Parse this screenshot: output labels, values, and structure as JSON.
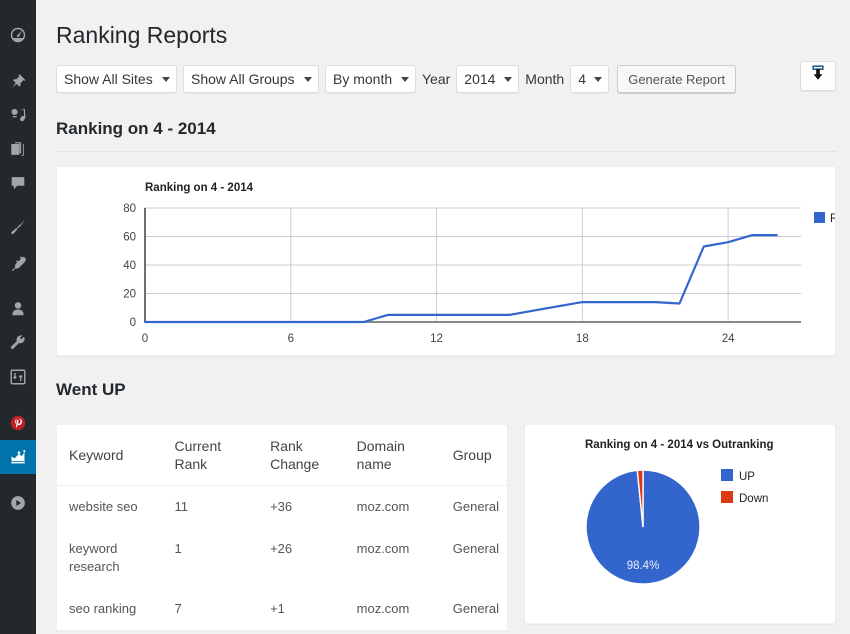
{
  "sidebar": {
    "items": [
      {
        "name": "dashboard",
        "icon": "dashboard-icon",
        "active": false
      },
      {
        "name": "posts",
        "icon": "pin-icon",
        "active": false
      },
      {
        "name": "media",
        "icon": "media-icon",
        "active": false
      },
      {
        "name": "pages",
        "icon": "pages-icon",
        "active": false
      },
      {
        "name": "comments",
        "icon": "comment-icon",
        "active": false
      },
      {
        "name": "appearance",
        "icon": "brush-icon",
        "active": false
      },
      {
        "name": "plugins",
        "icon": "plug-icon",
        "active": false
      },
      {
        "name": "users",
        "icon": "user-icon",
        "active": false
      },
      {
        "name": "tools",
        "icon": "wrench-icon",
        "active": false
      },
      {
        "name": "settings",
        "icon": "sliders-icon",
        "active": false
      },
      {
        "name": "pinterest",
        "icon": "pinterest-icon",
        "active": false
      },
      {
        "name": "rankings",
        "icon": "chart-icon",
        "active": true
      },
      {
        "name": "media-play",
        "icon": "play-icon",
        "active": false
      }
    ]
  },
  "header": {
    "title": "Ranking Reports"
  },
  "toolbar": {
    "site_filter": {
      "value": "Show All Sites",
      "options": [
        "Show All Sites"
      ]
    },
    "group_filter": {
      "value": "Show All Groups",
      "options": [
        "Show All Groups"
      ]
    },
    "period_filter": {
      "value": "By month",
      "options": [
        "By month"
      ]
    },
    "year_label": "Year",
    "year_value": "2014",
    "month_label": "Month",
    "month_value": "4",
    "generate_label": "Generate Report",
    "export_icon": "download-icon"
  },
  "sections": {
    "ranking_heading": "Ranking on 4 - 2014",
    "went_up_heading": "Went UP"
  },
  "table": {
    "columns": [
      "Keyword",
      "Current Rank",
      "Rank Change",
      "Domain name",
      "Group"
    ],
    "rows": [
      {
        "keyword": "website seo",
        "current_rank": "11",
        "rank_change": "+36",
        "domain": "moz.com",
        "group": "General"
      },
      {
        "keyword": "keyword research",
        "current_rank": "1",
        "rank_change": "+26",
        "domain": "moz.com",
        "group": "General"
      },
      {
        "keyword": "seo ranking",
        "current_rank": "7",
        "rank_change": "+1",
        "domain": "moz.com",
        "group": "General"
      }
    ]
  },
  "colors": {
    "series_blue": "#3366cc",
    "series_red": "#dc3912",
    "sidebar_bg": "#23282d",
    "sidebar_active": "#0073aa",
    "page_bg": "#f1f1f1"
  },
  "chart_data": [
    {
      "type": "line",
      "title": "Ranking on 4 - 2014",
      "xlabel": "",
      "ylabel": "",
      "xlim": [
        0,
        27
      ],
      "ylim": [
        0,
        80
      ],
      "xticks": [
        0,
        6,
        12,
        18,
        24
      ],
      "yticks": [
        0,
        20,
        40,
        60,
        80
      ],
      "grid": true,
      "legend": [
        "Rank"
      ],
      "legend_position": "right",
      "series": [
        {
          "name": "Rank",
          "color": "#3366cc",
          "x": [
            0,
            1,
            2,
            3,
            4,
            5,
            6,
            7,
            8,
            9,
            10,
            11,
            12,
            13,
            14,
            15,
            16,
            17,
            18,
            19,
            20,
            21,
            22,
            23,
            24,
            25,
            26
          ],
          "values": [
            0,
            0,
            0,
            0,
            0,
            0,
            0,
            0,
            0,
            0,
            5,
            5,
            5,
            5,
            5,
            5,
            8,
            11,
            14,
            14,
            14,
            14,
            13,
            53,
            56,
            61,
            61
          ]
        }
      ]
    },
    {
      "type": "pie",
      "title": "Ranking on 4 - 2014 vs Outranking",
      "labels": [
        "UP",
        "Down"
      ],
      "values": [
        98.4,
        1.6
      ],
      "data_labels": [
        "98.4%",
        ""
      ],
      "colors": [
        "#3366cc",
        "#dc3912"
      ],
      "legend": [
        "UP",
        "Down"
      ],
      "legend_position": "right"
    }
  ]
}
